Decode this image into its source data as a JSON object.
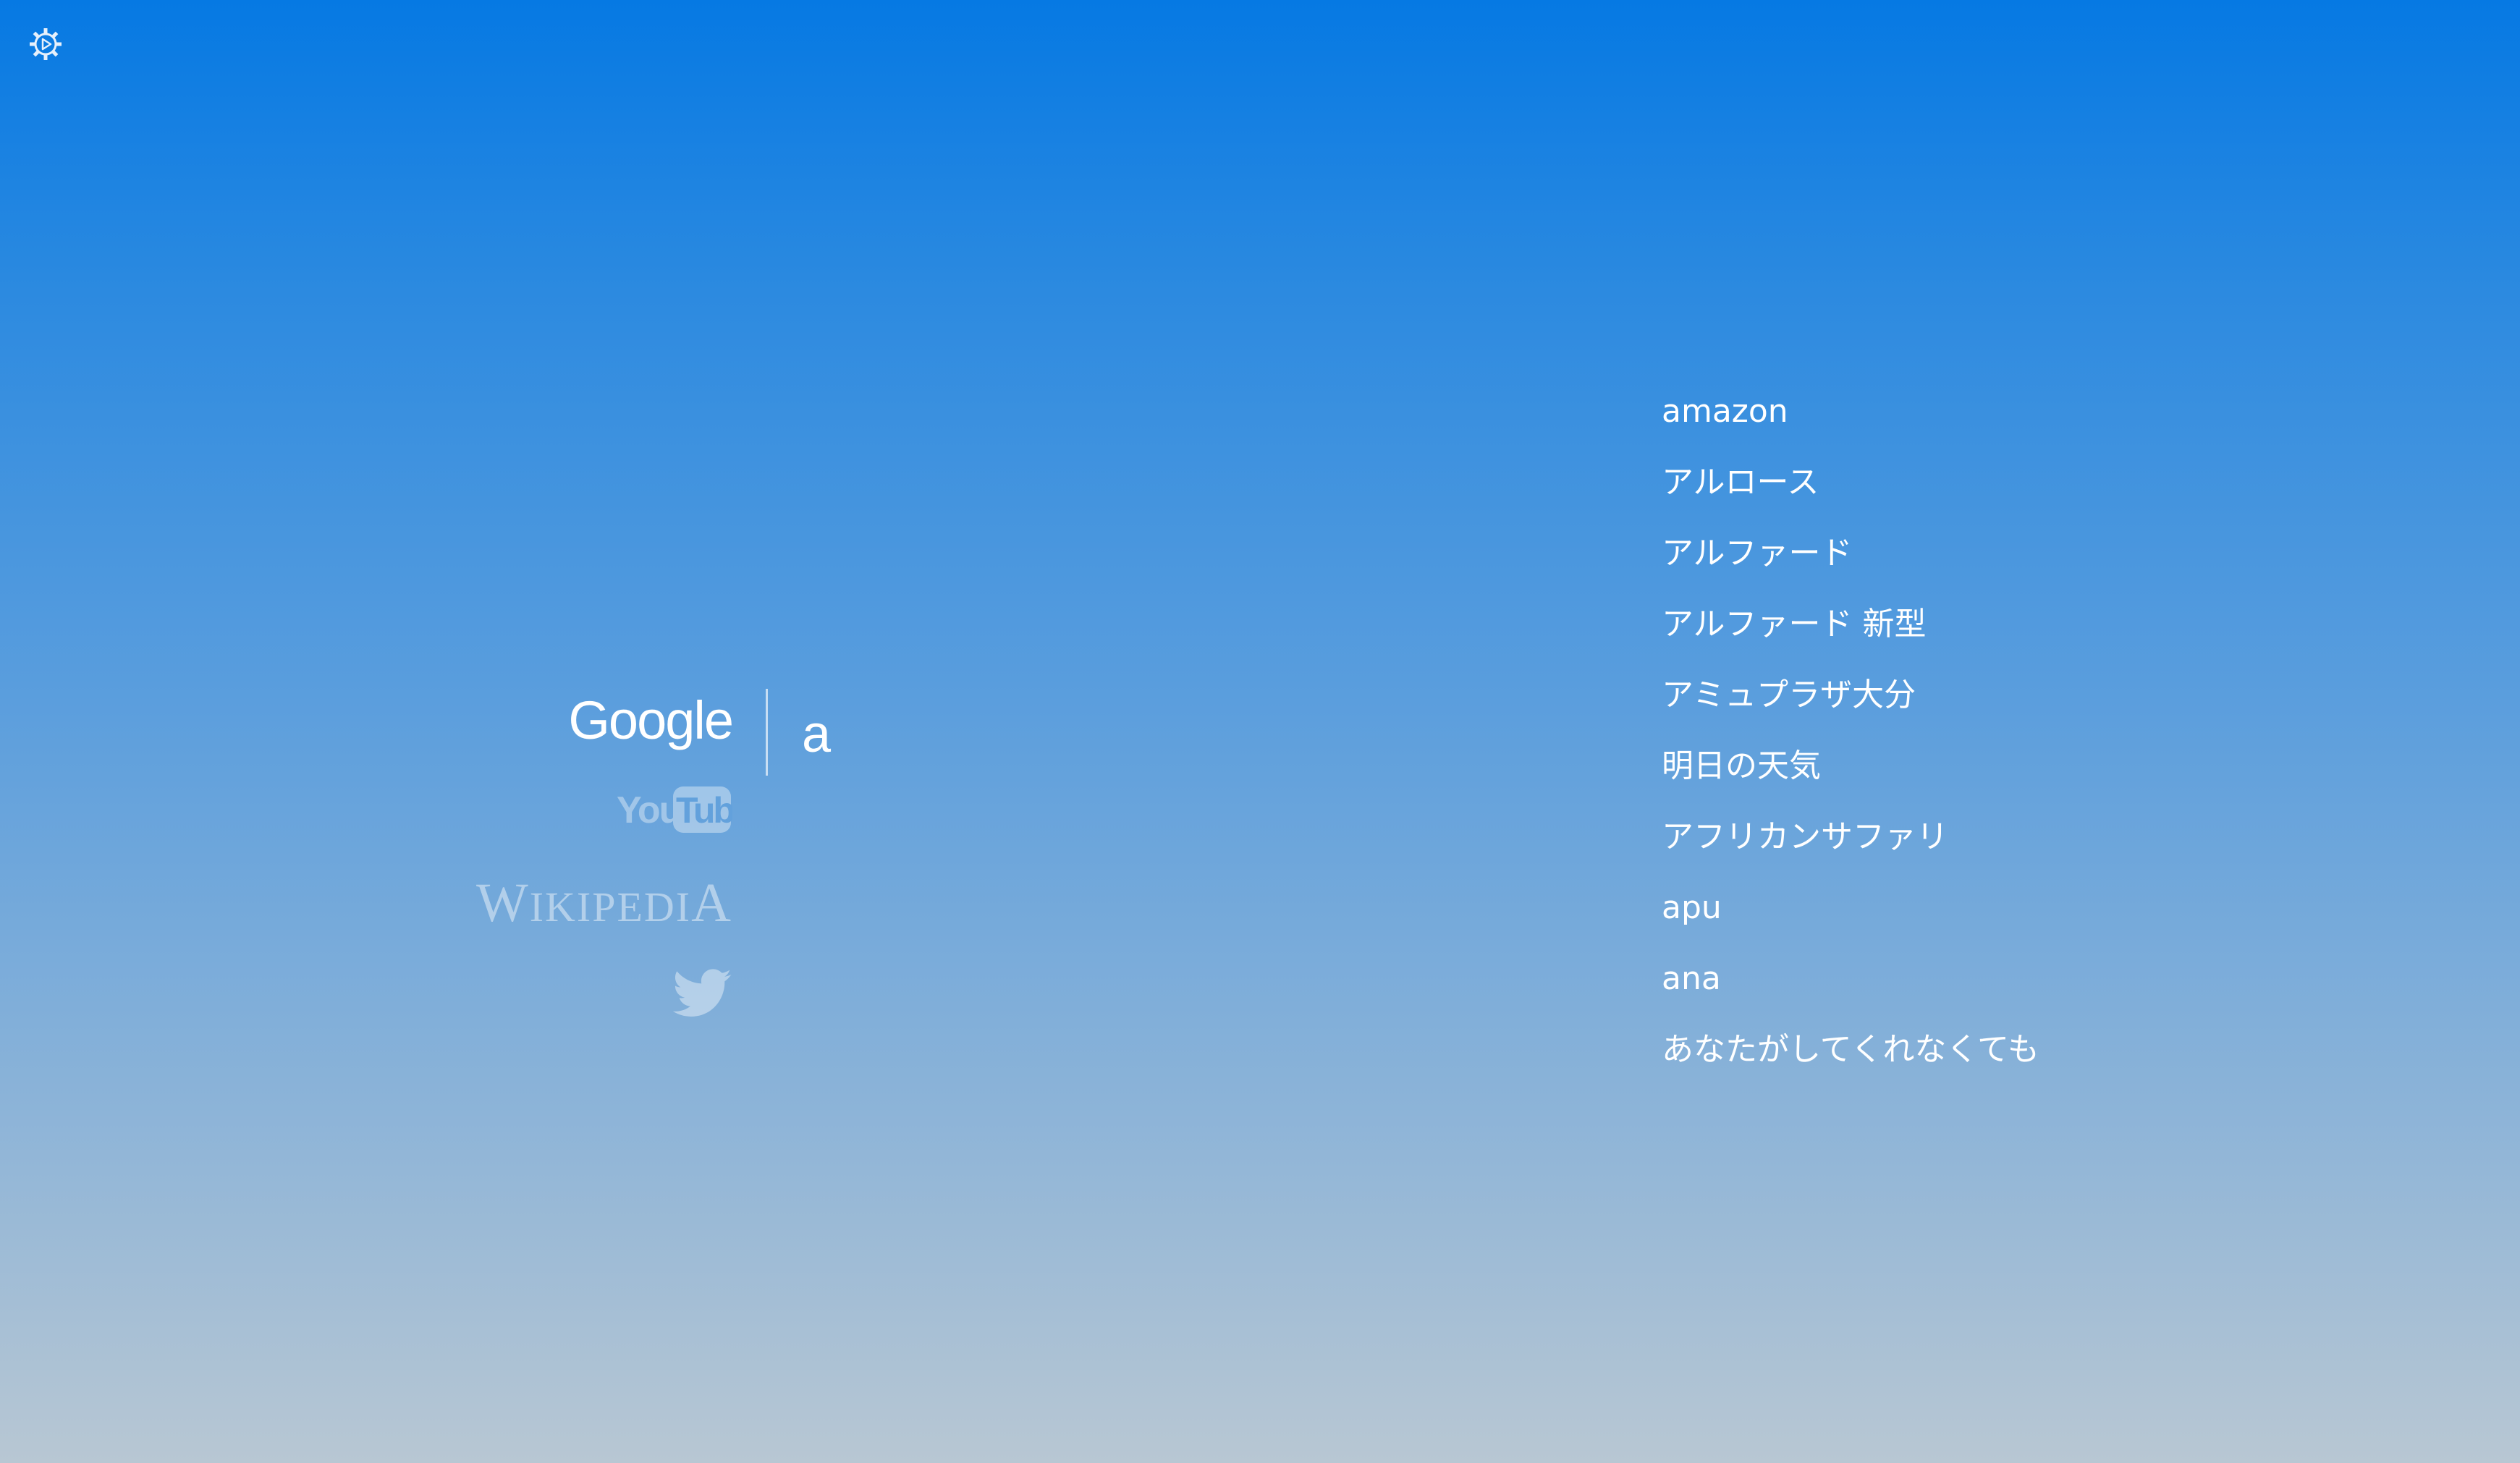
{
  "settings": {
    "icon": "gear-icon"
  },
  "engines": {
    "google": {
      "label": "Google",
      "icon": "google-logo"
    },
    "youtube": {
      "you": "You",
      "tube": "Tube",
      "icon": "youtube-logo"
    },
    "wikipedia": {
      "w": "W",
      "iki": "IKIPEDI",
      "a": "A",
      "icon": "wikipedia-logo"
    },
    "twitter": {
      "icon": "twitter-bird-icon"
    }
  },
  "search": {
    "query": "a"
  },
  "suggestions": [
    "amazon",
    "アルロース",
    "アルファード",
    "アルファード 新型",
    "アミュプラザ大分",
    "明日の天気",
    "アフリカンサファリ",
    "apu",
    "ana",
    "あなたがしてくれなくても"
  ],
  "colors": {
    "gradient_top": "#0679e3",
    "gradient_bottom": "#b8c7d3",
    "text": "#ffffff"
  }
}
